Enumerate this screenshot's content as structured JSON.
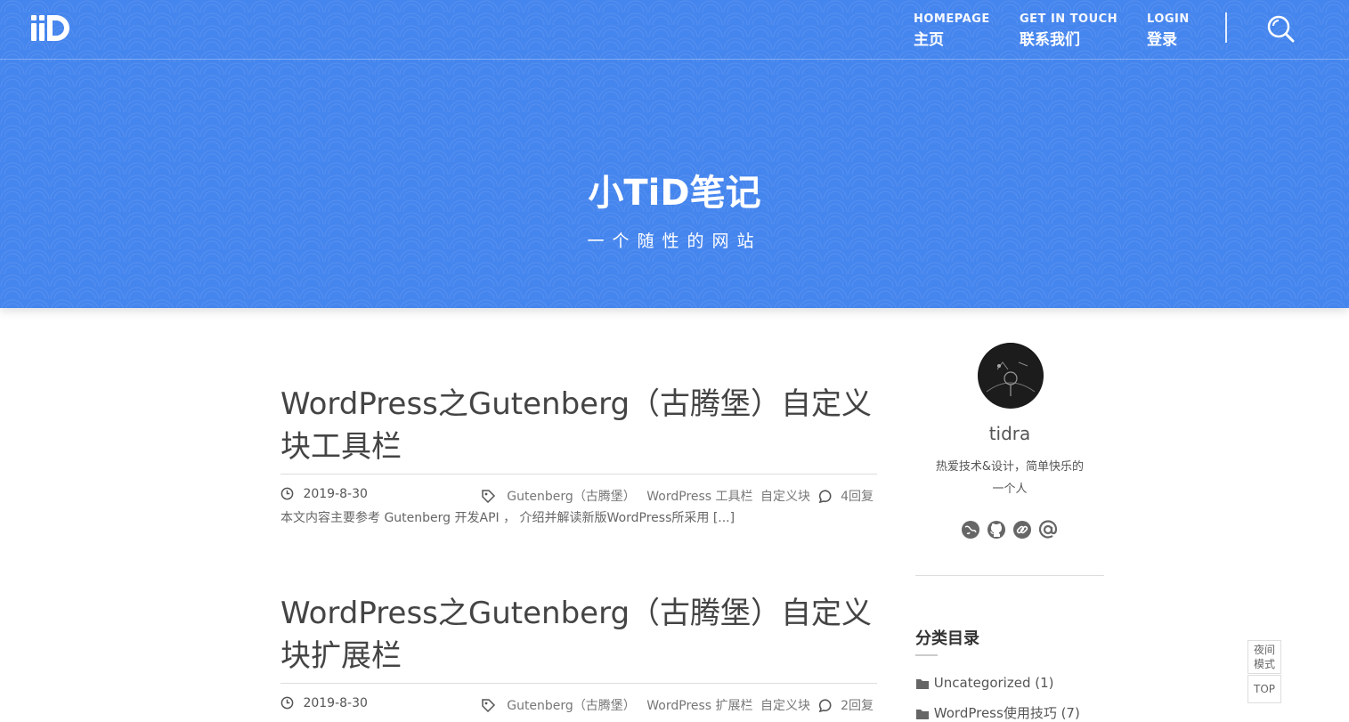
{
  "header": {
    "nav": [
      {
        "en": "HOMEPAGE",
        "cn": "主页"
      },
      {
        "en": "GET IN TOUCH",
        "cn": "联系我们"
      },
      {
        "en": "LOGIN",
        "cn": "登录"
      }
    ],
    "search_icon": "search-icon",
    "logo_icon": "tid-logo"
  },
  "hero": {
    "title": "小TiD笔记",
    "subtitle": "一个随性的网站"
  },
  "posts": [
    {
      "title_line1": "WordPress之Gutenberg（古腾堡）自定义",
      "title_line2": "块工具栏",
      "date": "2019-8-30",
      "tags": [
        "Gutenberg（古腾堡）",
        "WordPress 工具栏",
        "自定义块"
      ],
      "replies": "4回复",
      "excerpt": "本文内容主要参考 Gutenberg 开发API ， 介绍并解读新版WordPress所采用 [...]"
    },
    {
      "title_line1": "WordPress之Gutenberg（古腾堡）自定义",
      "title_line2": "块扩展栏",
      "date": "2019-8-30",
      "tags": [
        "Gutenberg（古腾堡）",
        "WordPress 扩展栏",
        "自定义块"
      ],
      "replies": "2回复"
    }
  ],
  "sidebar": {
    "author": "tidra",
    "bio_line1": "热爱技术&设计，简单快乐的",
    "bio_line2": "一个人",
    "socials": [
      "globe-icon",
      "github-icon",
      "link-icon",
      "at-icon"
    ],
    "categories_title": "分类目录",
    "categories": [
      {
        "label": "Uncategorized (1)"
      },
      {
        "label": "WordPress使用技巧 (7)"
      }
    ]
  },
  "float_buttons": {
    "night_line1": "夜间",
    "night_line2": "模式",
    "top": "TOP"
  },
  "colors": {
    "primary": "#4585ee",
    "text": "#444444"
  }
}
